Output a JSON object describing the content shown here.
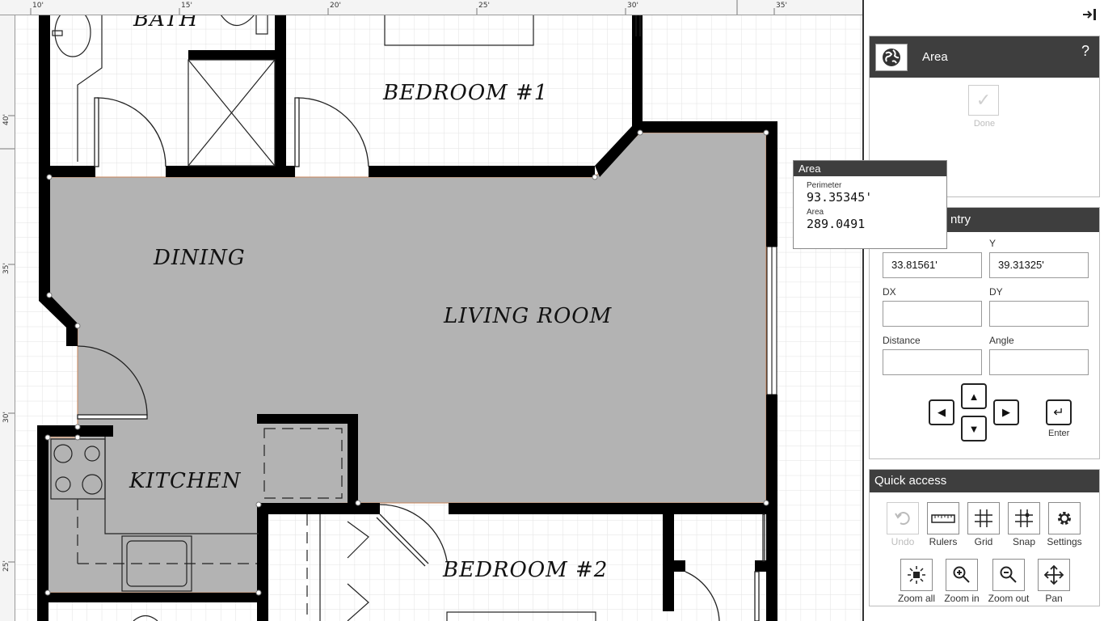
{
  "ruler": {
    "top_labels": [
      "10'",
      "15'",
      "20'",
      "25'",
      "30'",
      "35'"
    ],
    "left_labels": [
      "40'",
      "35'",
      "30'",
      "25'"
    ]
  },
  "rooms": {
    "bath": "BATH",
    "bedroom1": "BEDROOM #1",
    "dining": "DINING",
    "living": "LIVING ROOM",
    "kitchen": "KITCHEN",
    "bedroom2": "BEDROOM #2"
  },
  "tooltip": {
    "title": "Area",
    "perimeter_label": "Perimeter",
    "perimeter_value": "93.35345'",
    "area_label": "Area",
    "area_value": "289.0491"
  },
  "area_panel": {
    "title": "Area",
    "help": "?",
    "done_label": "Done"
  },
  "entry_panel": {
    "title_visible": "ntry",
    "x_value": "33.81561'",
    "y_label": "Y",
    "y_value": "39.31325'",
    "dx_label": "DX",
    "dx_value": "",
    "dy_label": "DY",
    "dy_value": "",
    "distance_label": "Distance",
    "distance_value": "",
    "angle_label": "Angle",
    "angle_value": "",
    "enter_label": "Enter"
  },
  "quick_access": {
    "title": "Quick access",
    "items_row1": [
      {
        "label": "Undo",
        "icon": "undo-icon",
        "enabled": false
      },
      {
        "label": "Rulers",
        "icon": "ruler-icon",
        "enabled": true
      },
      {
        "label": "Grid",
        "icon": "grid-icon",
        "enabled": true
      },
      {
        "label": "Snap",
        "icon": "snap-icon",
        "enabled": true
      },
      {
        "label": "Settings",
        "icon": "gear-icon",
        "enabled": true
      }
    ],
    "items_row2": [
      {
        "label": "Zoom all",
        "icon": "zoom-all-icon",
        "enabled": true
      },
      {
        "label": "Zoom in",
        "icon": "zoom-in-icon",
        "enabled": true
      },
      {
        "label": "Zoom out",
        "icon": "zoom-out-icon",
        "enabled": true
      },
      {
        "label": "Pan",
        "icon": "pan-icon",
        "enabled": true
      }
    ]
  },
  "colors": {
    "area_fill": "#b3b3b3",
    "wall": "#000000",
    "panel_header": "#3e3e3e"
  }
}
